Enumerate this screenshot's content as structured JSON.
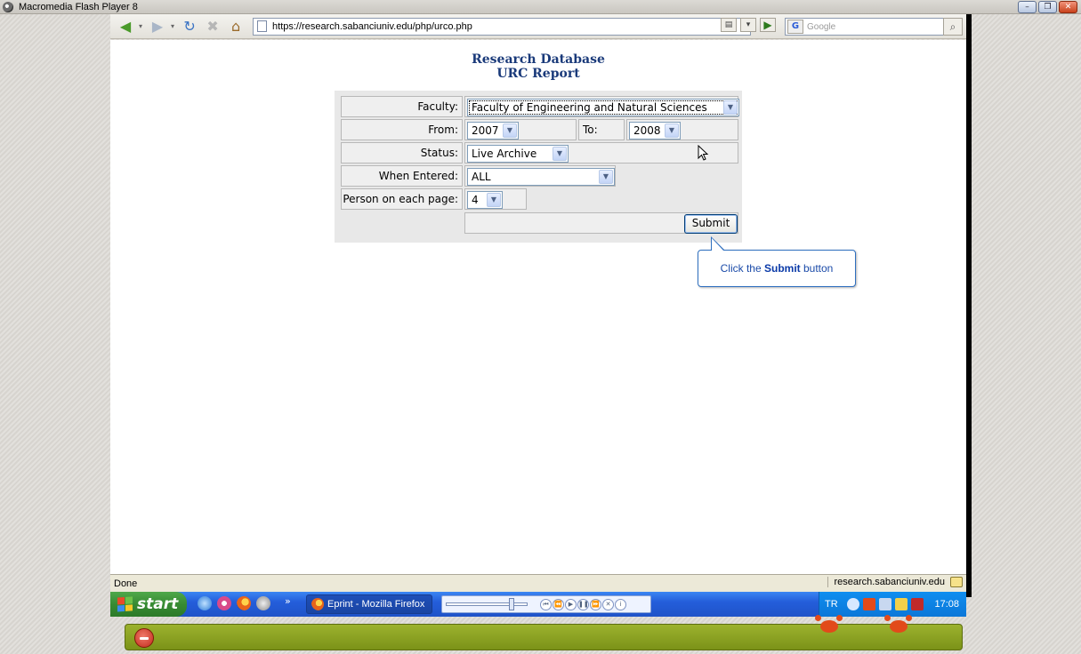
{
  "player": {
    "title": "Macromedia Flash Player 8",
    "window_buttons": [
      "–",
      "❐",
      "✕"
    ]
  },
  "browser": {
    "url": "https://research.sabanciuniv.edu/php/urco.php",
    "search_placeholder": "Google",
    "search_engine_icon": "G"
  },
  "page": {
    "title_line1": "Research Database",
    "title_line2": "URC Report"
  },
  "form": {
    "faculty": {
      "label": "Faculty:",
      "value": "Faculty of Engineering and Natural Sciences"
    },
    "from": {
      "label": "From:",
      "value": "2007"
    },
    "to": {
      "label": "To:",
      "value": "2008"
    },
    "status": {
      "label": "Status:",
      "value": "Live Archive"
    },
    "when_entered": {
      "label": "When Entered:",
      "value": "ALL"
    },
    "per_page": {
      "label": "Person on each page:",
      "value": "4"
    },
    "submit_label": "Submit"
  },
  "callout": {
    "prefix": "Click the ",
    "emphasis": "Submit",
    "suffix": " button"
  },
  "statusbar": {
    "left": "Done",
    "right": "research.sabanciuniv.edu"
  },
  "taskbar": {
    "start_label": "start",
    "task_label": "Eprint - Mozilla Firefox",
    "chevron": "»",
    "lang": "TR",
    "time": "17:08"
  }
}
